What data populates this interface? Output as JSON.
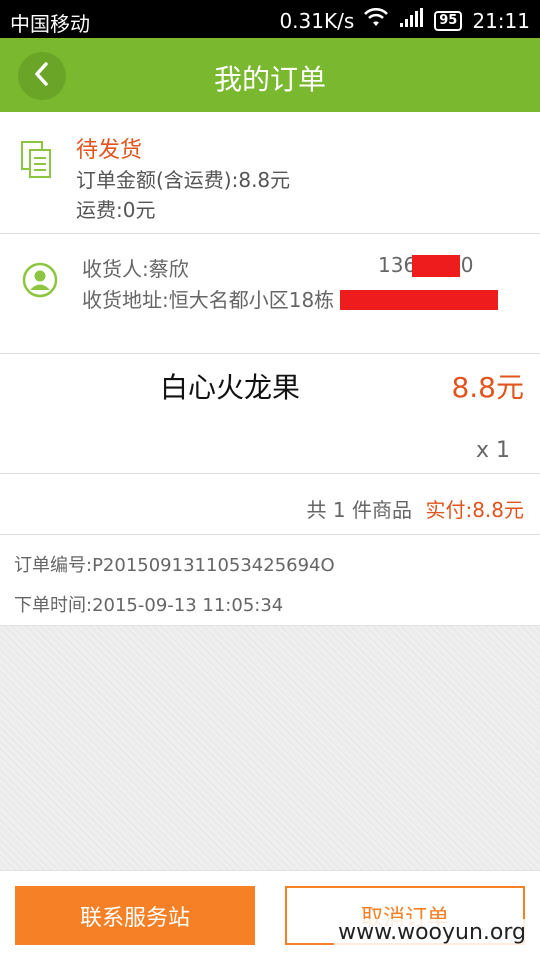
{
  "status_bar": {
    "carrier": "中国移动",
    "speed": "0.31K/s",
    "battery": "95",
    "time": "21:11"
  },
  "header": {
    "title": "我的订单"
  },
  "order_status": {
    "status": "待发货",
    "amount_text": "订单金额(含运费):8.8元",
    "shipping_text": "运费:0元"
  },
  "recipient": {
    "name_text": "收货人:蔡欣",
    "phone_text": "136       6630",
    "address_text": "收货地址:恒大名都小区18栋                    号"
  },
  "item": {
    "name": "白心火龙果",
    "price": "8.8元",
    "quantity": "x 1"
  },
  "summary": {
    "count_text": "共 1 件商品",
    "paid_text": "实付:8.8元"
  },
  "meta": {
    "order_no_text": "订单编号:P2015091311053425694O",
    "order_time_text": "下单时间:2015-09-13 11:05:34"
  },
  "actions": {
    "contact_label": "联系服务站",
    "cancel_label": "取消订单"
  },
  "watermark": "www.wooyun.org",
  "colors": {
    "header_green": "#7ab830",
    "accent_orange": "#e1541d",
    "button_orange": "#f58025",
    "redaction_red": "#ee1c1c"
  },
  "icons": {
    "back": "chevron-left-icon",
    "status": "document-icon",
    "recipient": "user-icon",
    "wifi": "wifi-icon",
    "signal": "signal-icon",
    "battery": "battery-icon"
  }
}
